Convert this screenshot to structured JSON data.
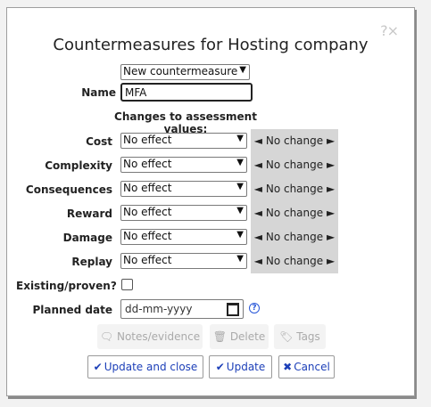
{
  "dialog": {
    "title": "Countermeasures for Hosting company",
    "corner_help": "?",
    "corner_close": "×"
  },
  "countermeasure_select": {
    "value": "New countermeasure"
  },
  "name": {
    "label": "Name",
    "value": "MFA"
  },
  "changes_heading": "Changes to assessment values:",
  "rows": [
    {
      "label": "Cost",
      "select": "No effect",
      "change": "No change"
    },
    {
      "label": "Complexity",
      "select": "No effect",
      "change": "No change"
    },
    {
      "label": "Consequences",
      "select": "No effect",
      "change": "No change"
    },
    {
      "label": "Reward",
      "select": "No effect",
      "change": "No change"
    },
    {
      "label": "Damage",
      "select": "No effect",
      "change": "No change"
    },
    {
      "label": "Replay",
      "select": "No effect",
      "change": "No change"
    }
  ],
  "arrows": {
    "left": "◄",
    "right": "►"
  },
  "existing": {
    "label": "Existing/proven?",
    "checked": false
  },
  "planned": {
    "label": "Planned date",
    "placeholder": "dd-mm-yyyy",
    "help": "?"
  },
  "secondary_buttons": {
    "notes": "Notes/evidence",
    "delete": "Delete",
    "tags": "Tags"
  },
  "primary_buttons": {
    "update_close": "Update and close",
    "update": "Update",
    "cancel": "Cancel"
  },
  "icons": {
    "check": "✔",
    "cancel": "✖"
  }
}
